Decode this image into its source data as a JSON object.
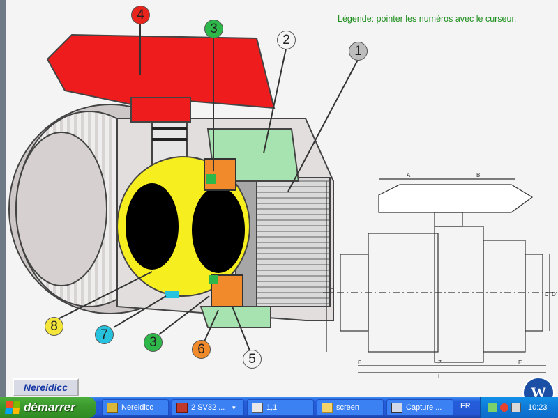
{
  "legend": "Légende: pointer les numéros avec le curseur.",
  "callouts": [
    {
      "num": "4",
      "color": "#e8241c"
    },
    {
      "num": "3",
      "color": "#2fb84a"
    },
    {
      "num": "2",
      "color": "#f4f4f4"
    },
    {
      "num": "1",
      "color": "#bdbdbd"
    },
    {
      "num": "8",
      "color": "#f4e53a"
    },
    {
      "num": "7",
      "color": "#27c3de"
    },
    {
      "num": "3",
      "color": "#2fb84a"
    },
    {
      "num": "6",
      "color": "#f08a2a"
    },
    {
      "num": "5",
      "color": "#f4f4f4"
    }
  ],
  "dimensions": {
    "a": "A",
    "b": "B",
    "c": "C",
    "d": "D",
    "g": "G",
    "e": "E",
    "z": "Z",
    "l": "L"
  },
  "brand_button": "Nereidicc",
  "logo_letter": "W",
  "taskbar": {
    "start_label": "démarrer",
    "tasks": [
      {
        "label": "Nereidicc"
      },
      {
        "label": "2 SV32 ..."
      },
      {
        "label": "1,1"
      },
      {
        "label": "screen"
      },
      {
        "label": "Capture ..."
      }
    ],
    "language": "FR",
    "clock": "10:23"
  },
  "colors": {
    "handle": "#ee1c1c",
    "ball": "#f6ee1e",
    "seal_orange": "#f08a2a",
    "seal_green": "#a6e3b0",
    "taskbar": "#245edb",
    "start": "#3c9a2e"
  }
}
